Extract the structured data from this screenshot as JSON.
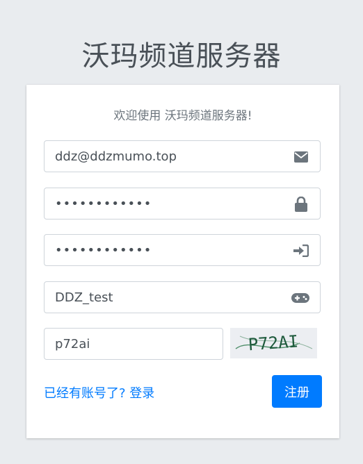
{
  "header": {
    "title": "沃玛频道服务器"
  },
  "card": {
    "welcome": "欢迎使用 沃玛频道服务器!"
  },
  "form": {
    "email_value": "ddz@ddzmumo.top",
    "password_value": "••••••••••••",
    "confirm_password_value": "••••••••••••",
    "username_value": "DDZ_test",
    "captcha_value": "p72ai",
    "captcha_image_text": "P72AI",
    "email_icon": "envelope-icon",
    "password_icon": "lock-icon",
    "confirm_password_icon": "sign-in-icon",
    "username_icon": "gamepad-icon"
  },
  "footer": {
    "login_link": "已经有账号了? 登录",
    "register_button": "注册"
  },
  "colors": {
    "background": "#e9ecef",
    "primary": "#007bff",
    "icon": "#6c757d",
    "captcha_text": "#1e5a3c"
  }
}
